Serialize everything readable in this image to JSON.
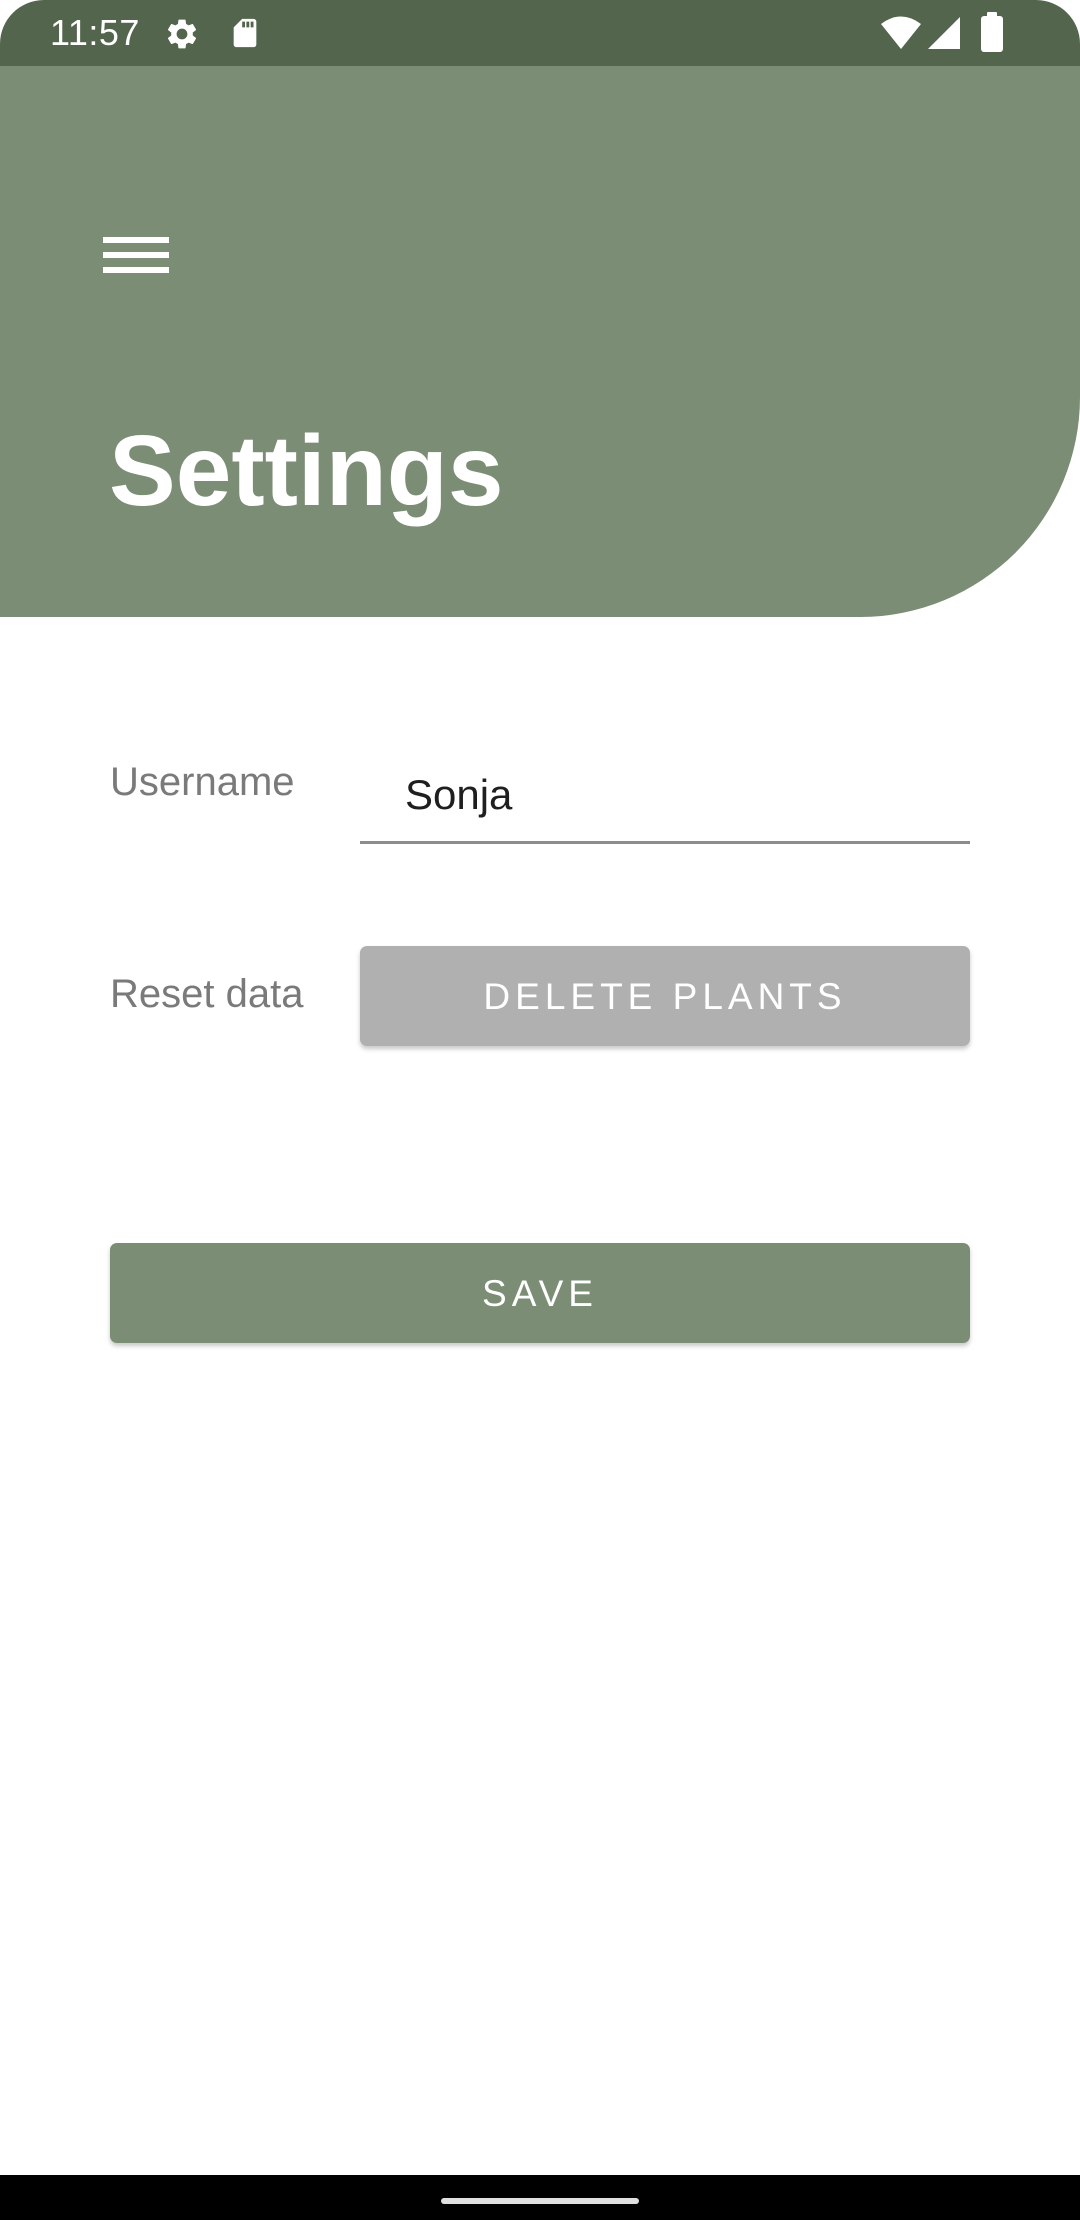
{
  "status_bar": {
    "time": "11:57",
    "left_icons": [
      "gear-icon",
      "sd-card-icon"
    ],
    "right_icons": [
      "wifi-icon",
      "cell-signal-icon",
      "battery-icon"
    ]
  },
  "header": {
    "menu_icon": "hamburger-menu-icon",
    "title": "Settings"
  },
  "form": {
    "username_label": "Username",
    "username_value": "Sonja",
    "reset_label": "Reset data",
    "delete_button_label": "DELETE PLANTS"
  },
  "save_button_label": "SAVE",
  "colors": {
    "status_bar": "#53654c",
    "header": "#7b8d74",
    "accent": "#7b8d74",
    "disabled_button": "#b0b0b0",
    "label_text": "#7a7a7a"
  }
}
